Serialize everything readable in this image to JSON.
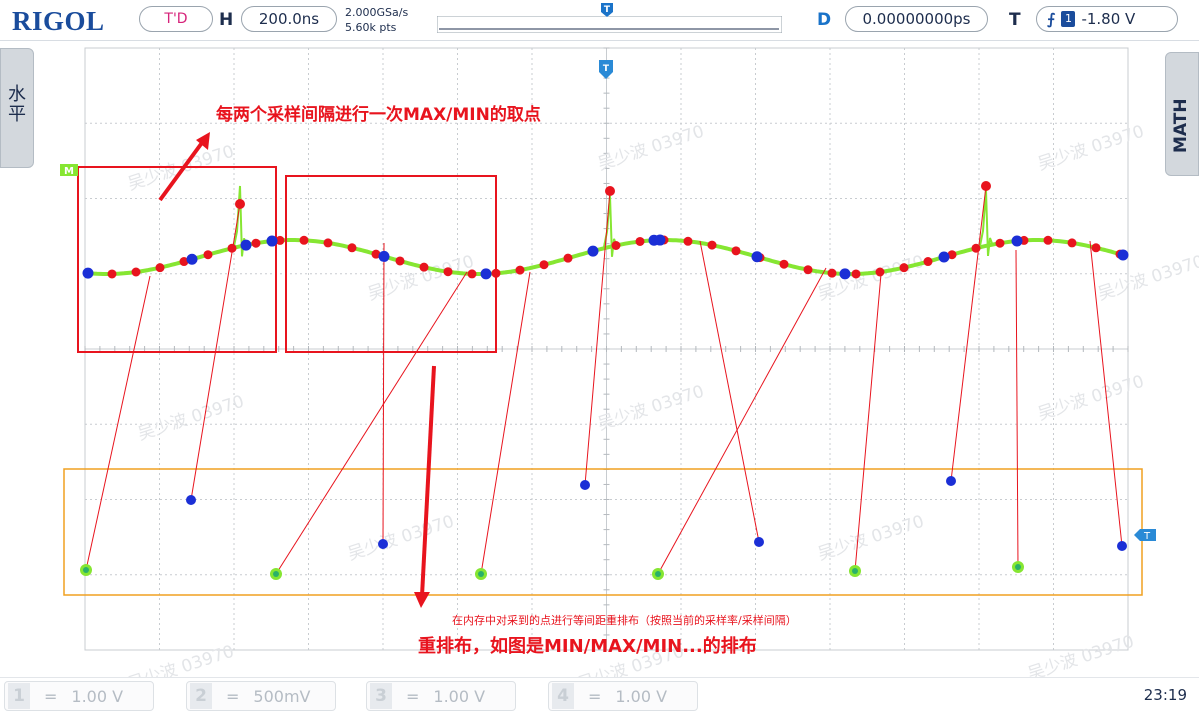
{
  "header": {
    "logo": "RIGOL",
    "mode": "T'D",
    "horizontal_label": "H",
    "timebase": "200.0ns",
    "sample_rate": "2.000GSa/s",
    "memory_depth": "5.60k pts",
    "delay_label": "D",
    "delay_value": "0.00000000ps",
    "trigger_label": "T",
    "trigger_channel": "1",
    "trigger_level": "-1.80 V"
  },
  "side_tabs": {
    "left": "水平",
    "right": "MATH"
  },
  "markers": {
    "math": "M",
    "trigger": "T"
  },
  "annotations": {
    "top": "每两个采样间隔进行一次MAX/MIN的取点",
    "bottom_small": "在内存中对采到的点进行等间距重排布（按照当前的采样率/采样间隔）",
    "bottom_big": "重排布，如图是MIN/MAX/MIN...的排布"
  },
  "watermark": "吴少波 03970",
  "channels": [
    {
      "num": "1",
      "coupling": "=",
      "scale": "1.00 V"
    },
    {
      "num": "2",
      "coupling": "=",
      "scale": "500mV"
    },
    {
      "num": "3",
      "coupling": "=",
      "scale": "1.00 V"
    },
    {
      "num": "4",
      "coupling": "=",
      "scale": "1.00 V"
    }
  ],
  "clock": "23:19",
  "colors": {
    "waveform": "#86e632",
    "max_point": "#e8141e",
    "min_point": "#1b2fd6",
    "annotation": "#e8141e",
    "highlight_box": "#f0a020",
    "grid": "#c8ccd0",
    "brand": "#1a4c9c"
  }
}
